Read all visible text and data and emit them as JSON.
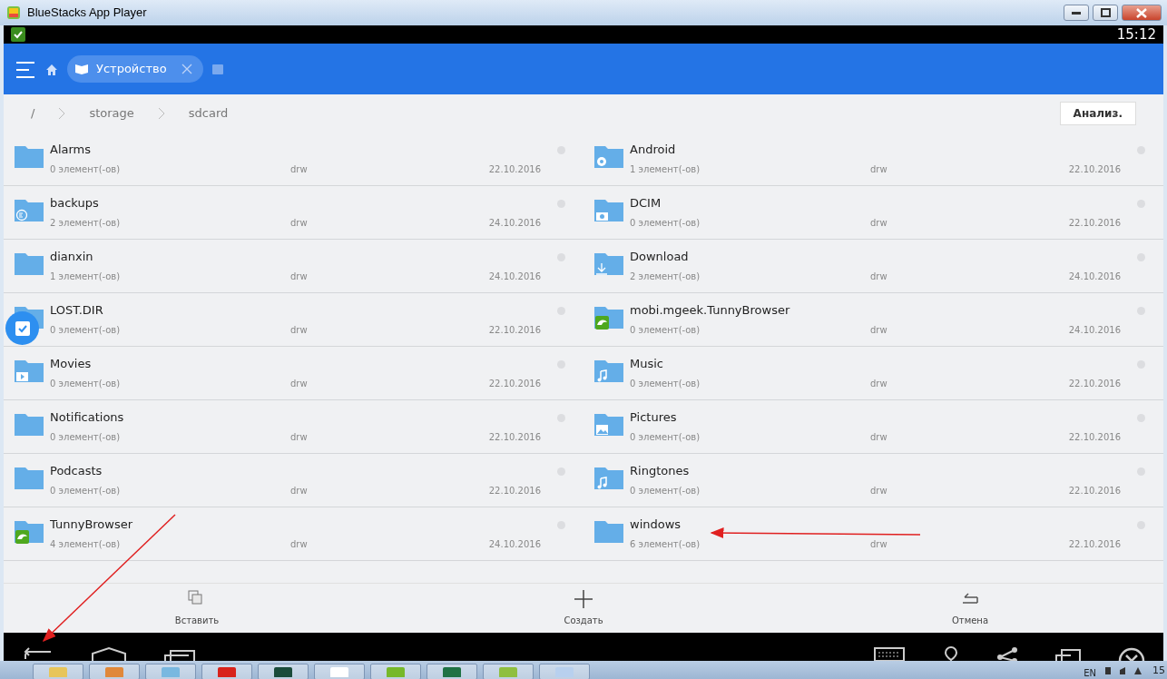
{
  "window": {
    "title": "BlueStacks App Player"
  },
  "status_bar": {
    "time": "15:12"
  },
  "header": {
    "tab": {
      "label": "Устройство",
      "selected": true
    }
  },
  "breadcrumb": {
    "items": [
      "/",
      "storage",
      "sdcard"
    ],
    "analyze_button": "Анализ."
  },
  "files": [
    {
      "name": "Alarms",
      "count": "0 элемент(-ов)",
      "perm": "drw",
      "date": "22.10.2016",
      "kind": "plain"
    },
    {
      "name": "Android",
      "count": "1 элемент(-ов)",
      "perm": "drw",
      "date": "22.10.2016",
      "kind": "gear"
    },
    {
      "name": "backups",
      "count": "2 элемент(-ов)",
      "perm": "drw",
      "date": "24.10.2016",
      "kind": "es"
    },
    {
      "name": "DCIM",
      "count": "0 элемент(-ов)",
      "perm": "drw",
      "date": "22.10.2016",
      "kind": "camera"
    },
    {
      "name": "dianxin",
      "count": "1 элемент(-ов)",
      "perm": "drw",
      "date": "24.10.2016",
      "kind": "plain"
    },
    {
      "name": "Download",
      "count": "2 элемент(-ов)",
      "perm": "drw",
      "date": "24.10.2016",
      "kind": "download"
    },
    {
      "name": "LOST.DIR",
      "count": "0 элемент(-ов)",
      "perm": "drw",
      "date": "22.10.2016",
      "kind": "plain"
    },
    {
      "name": "mobi.mgeek.TunnyBrowser",
      "count": "0 элемент(-ов)",
      "perm": "drw",
      "date": "24.10.2016",
      "kind": "dolphin"
    },
    {
      "name": "Movies",
      "count": "0 элемент(-ов)",
      "perm": "drw",
      "date": "22.10.2016",
      "kind": "play"
    },
    {
      "name": "Music",
      "count": "0 элемент(-ов)",
      "perm": "drw",
      "date": "22.10.2016",
      "kind": "music"
    },
    {
      "name": "Notifications",
      "count": "0 элемент(-ов)",
      "perm": "drw",
      "date": "22.10.2016",
      "kind": "plain"
    },
    {
      "name": "Pictures",
      "count": "0 элемент(-ов)",
      "perm": "drw",
      "date": "22.10.2016",
      "kind": "image"
    },
    {
      "name": "Podcasts",
      "count": "0 элемент(-ов)",
      "perm": "drw",
      "date": "22.10.2016",
      "kind": "plain"
    },
    {
      "name": "Ringtones",
      "count": "0 элемент(-ов)",
      "perm": "drw",
      "date": "22.10.2016",
      "kind": "music"
    },
    {
      "name": "TunnyBrowser",
      "count": "4 элемент(-ов)",
      "perm": "drw",
      "date": "24.10.2016",
      "kind": "dolphin"
    },
    {
      "name": "windows",
      "count": "6 элемент(-ов)",
      "perm": "drw",
      "date": "22.10.2016",
      "kind": "plain"
    }
  ],
  "toolbar": [
    {
      "label": "Вставить",
      "kind": "paste"
    },
    {
      "label": "Создать",
      "kind": "create"
    },
    {
      "label": "Отмена",
      "kind": "undo"
    }
  ],
  "taskbar": {
    "language": "EN",
    "clock": "15"
  }
}
